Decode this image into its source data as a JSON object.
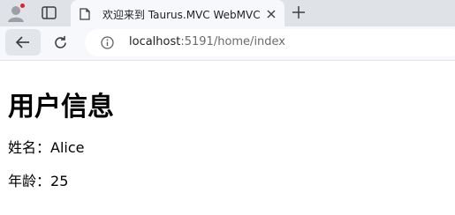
{
  "browser": {
    "tab": {
      "title": "欢迎来到 Taurus.MVC WebMVC"
    },
    "address": {
      "host": "localhost",
      "rest": ":5191/home/index"
    }
  },
  "page": {
    "heading": "用户信息",
    "name_label": "姓名：",
    "name_value": "Alice",
    "age_label": "年龄：",
    "age_value": "25"
  },
  "colors": {
    "tabbar": "#dfe3e8",
    "toolbar": "#f6f8fb",
    "profile_dot": "#e0202b"
  },
  "icons": [
    "profile-icon",
    "tab-actions-icon",
    "page-favicon-icon",
    "close-tab-icon",
    "new-tab-icon",
    "back-arrow-icon",
    "reload-icon",
    "site-info-icon"
  ]
}
